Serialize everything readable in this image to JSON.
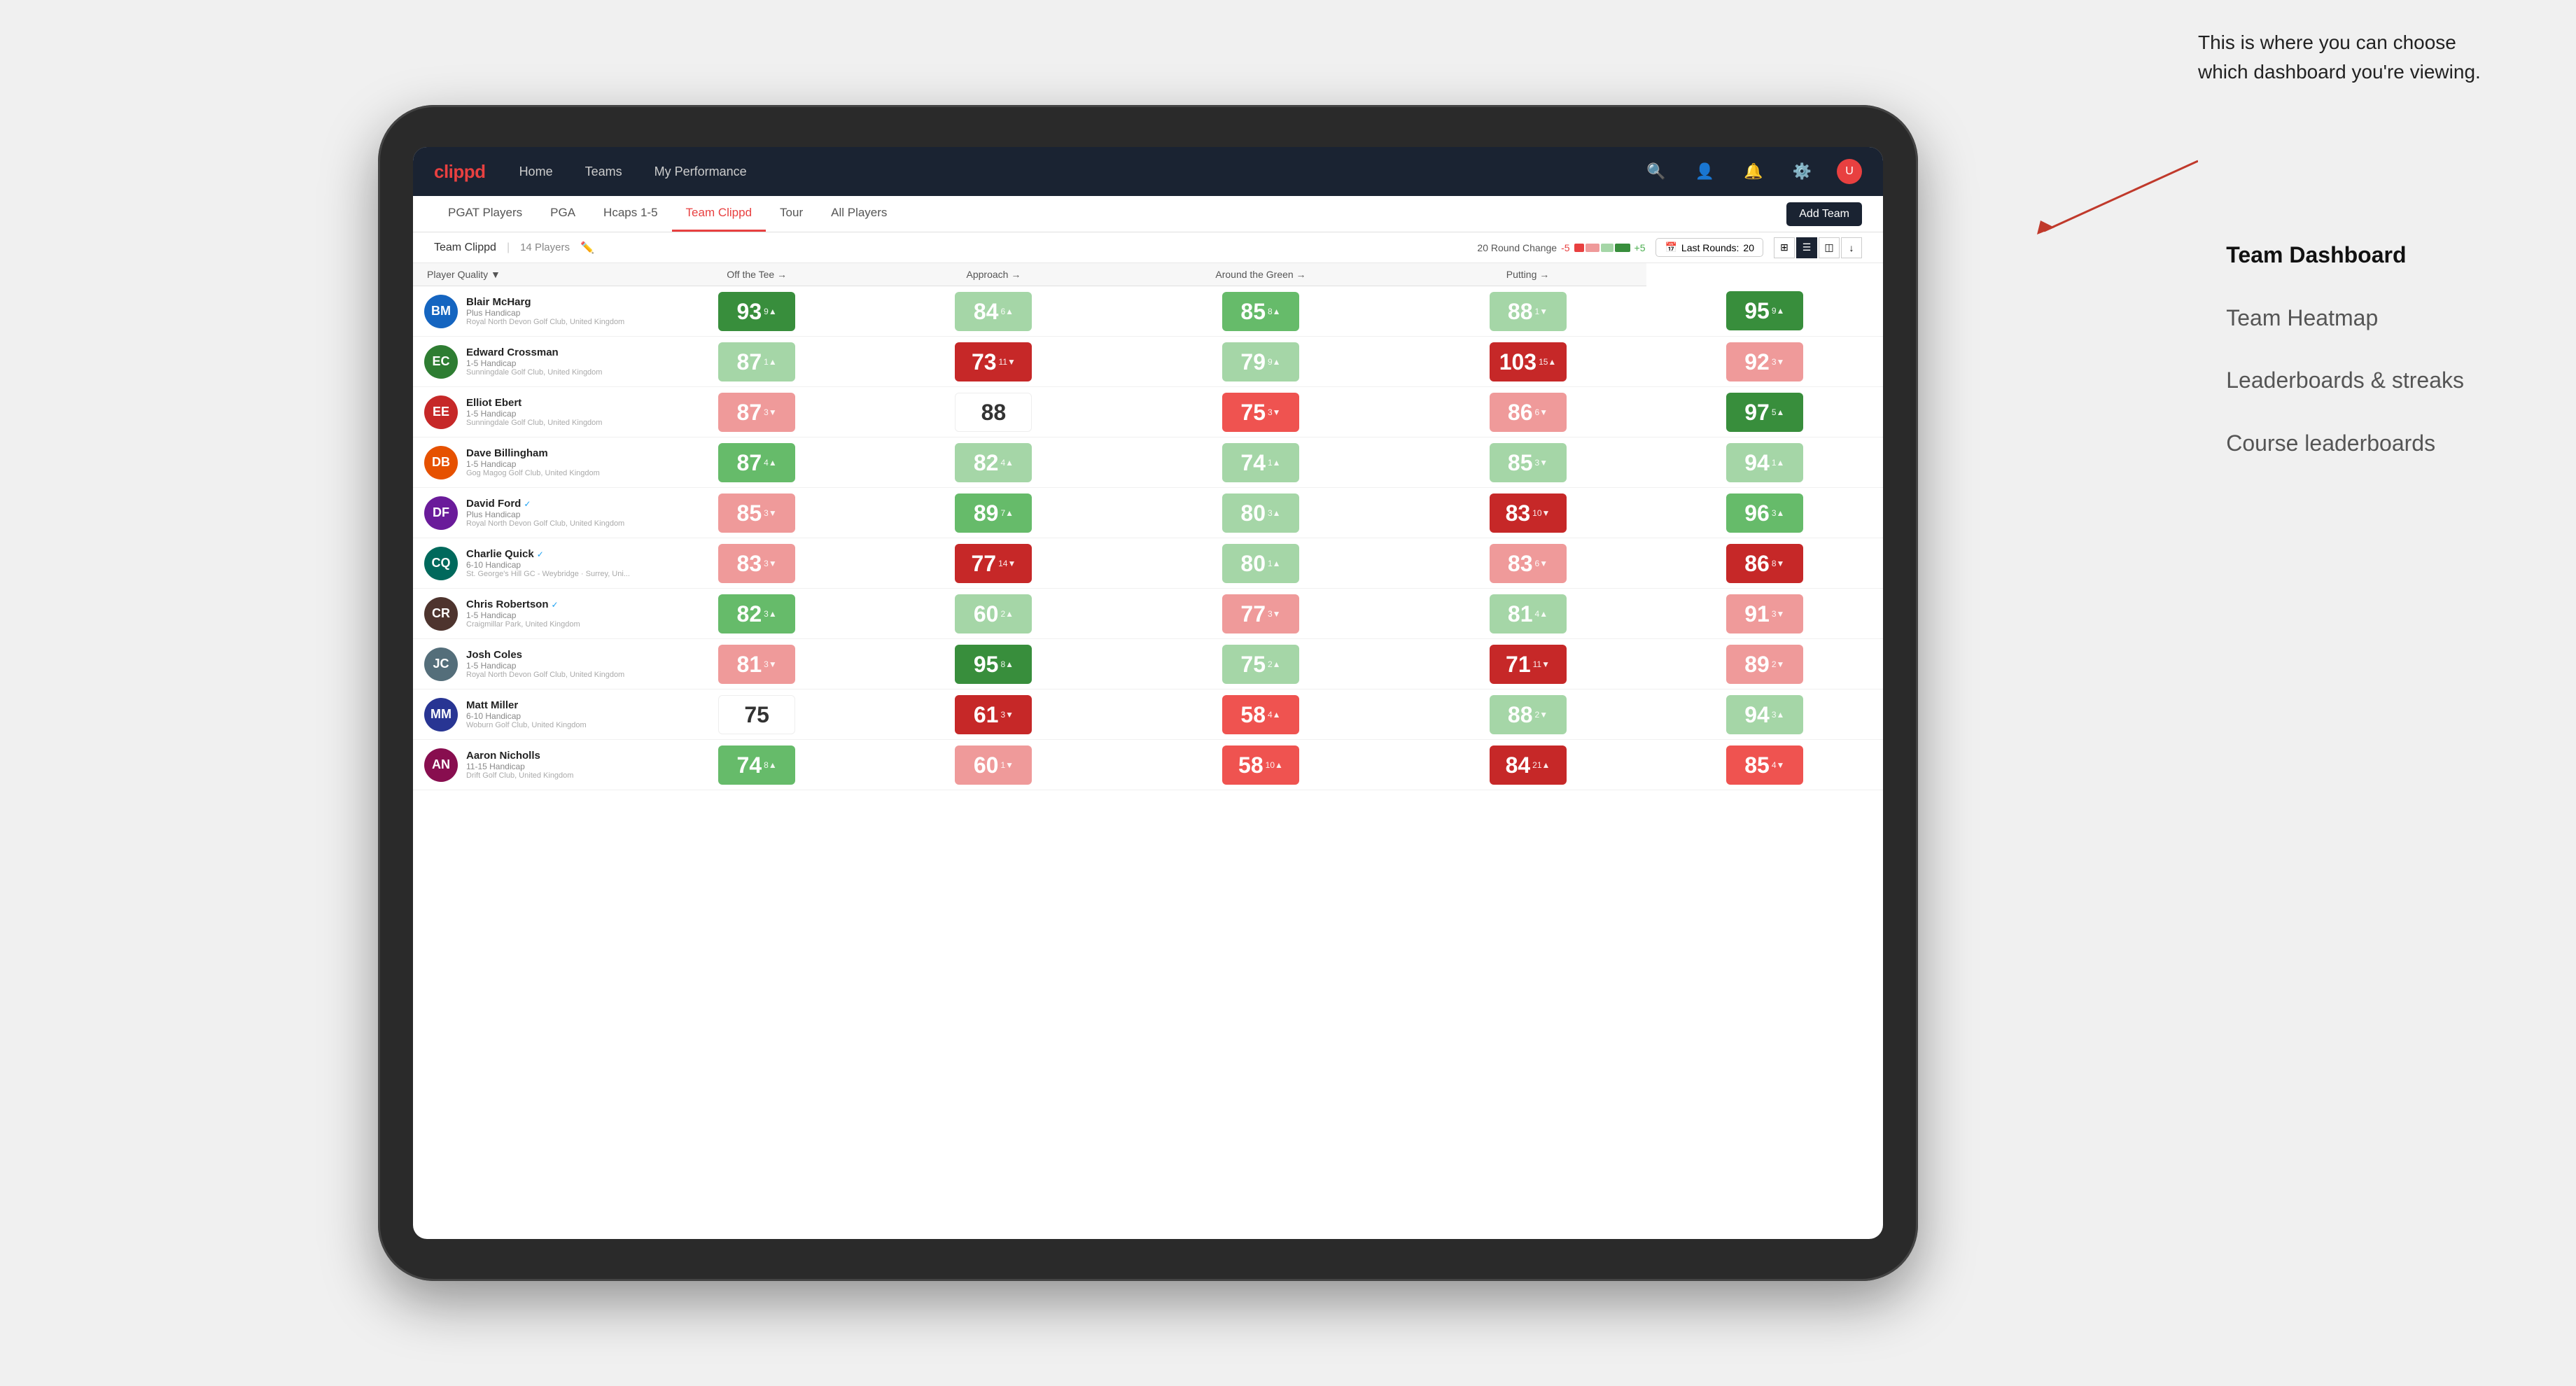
{
  "annotation": {
    "intro": "This is where you can choose which dashboard you're viewing.",
    "items": [
      "Team Dashboard",
      "Team Heatmap",
      "Leaderboards & streaks",
      "Course leaderboards"
    ]
  },
  "nav": {
    "logo": "clippd",
    "links": [
      "Home",
      "Teams",
      "My Performance"
    ],
    "icons": [
      "search",
      "person",
      "notifications",
      "settings"
    ]
  },
  "sub_nav": {
    "links": [
      "PGAT Players",
      "PGA",
      "Hcaps 1-5",
      "Team Clippd",
      "Tour",
      "All Players"
    ],
    "active": "Team Clippd",
    "add_team": "Add Team"
  },
  "team_bar": {
    "name": "Team Clippd",
    "separator": "|",
    "count": "14 Players",
    "round_change_label": "20 Round Change",
    "neg": "-5",
    "pos": "+5",
    "last_rounds_label": "Last Rounds:",
    "last_rounds_value": "20"
  },
  "table": {
    "headers": [
      "Player Quality ▼",
      "Off the Tee →",
      "Approach →",
      "Around the Green →",
      "Putting →"
    ],
    "players": [
      {
        "name": "Blair McHarg",
        "handicap": "Plus Handicap",
        "club": "Royal North Devon Golf Club, United Kingdom",
        "av_color": "av-blue",
        "av_initials": "BM",
        "scores": [
          {
            "value": "93",
            "change": "9",
            "dir": "up",
            "color": "green-dark"
          },
          {
            "value": "84",
            "change": "6",
            "dir": "up",
            "color": "green-light"
          },
          {
            "value": "85",
            "change": "8",
            "dir": "up",
            "color": "green-med"
          },
          {
            "value": "88",
            "change": "1",
            "dir": "down",
            "color": "green-light"
          },
          {
            "value": "95",
            "change": "9",
            "dir": "up",
            "color": "green-dark"
          }
        ]
      },
      {
        "name": "Edward Crossman",
        "handicap": "1-5 Handicap",
        "club": "Sunningdale Golf Club, United Kingdom",
        "av_color": "av-green",
        "av_initials": "EC",
        "scores": [
          {
            "value": "87",
            "change": "1",
            "dir": "up",
            "color": "green-light"
          },
          {
            "value": "73",
            "change": "11",
            "dir": "down",
            "color": "red-dark"
          },
          {
            "value": "79",
            "change": "9",
            "dir": "up",
            "color": "green-light"
          },
          {
            "value": "103",
            "change": "15",
            "dir": "up",
            "color": "red-dark"
          },
          {
            "value": "92",
            "change": "3",
            "dir": "down",
            "color": "red-light"
          }
        ]
      },
      {
        "name": "Elliot Ebert",
        "handicap": "1-5 Handicap",
        "club": "Sunningdale Golf Club, United Kingdom",
        "av_color": "av-red",
        "av_initials": "EE",
        "scores": [
          {
            "value": "87",
            "change": "3",
            "dir": "down",
            "color": "red-light"
          },
          {
            "value": "88",
            "change": "",
            "dir": "",
            "color": "white-cell"
          },
          {
            "value": "75",
            "change": "3",
            "dir": "down",
            "color": "red-med"
          },
          {
            "value": "86",
            "change": "6",
            "dir": "down",
            "color": "red-light"
          },
          {
            "value": "97",
            "change": "5",
            "dir": "up",
            "color": "green-dark"
          }
        ]
      },
      {
        "name": "Dave Billingham",
        "handicap": "1-5 Handicap",
        "club": "Gog Magog Golf Club, United Kingdom",
        "av_color": "av-orange",
        "av_initials": "DB",
        "scores": [
          {
            "value": "87",
            "change": "4",
            "dir": "up",
            "color": "green-med"
          },
          {
            "value": "82",
            "change": "4",
            "dir": "up",
            "color": "green-light"
          },
          {
            "value": "74",
            "change": "1",
            "dir": "up",
            "color": "green-light"
          },
          {
            "value": "85",
            "change": "3",
            "dir": "down",
            "color": "green-light"
          },
          {
            "value": "94",
            "change": "1",
            "dir": "up",
            "color": "green-light"
          }
        ]
      },
      {
        "name": "David Ford",
        "handicap": "Plus Handicap",
        "club": "Royal North Devon Golf Club, United Kingdom",
        "verified": true,
        "av_color": "av-purple",
        "av_initials": "DF",
        "scores": [
          {
            "value": "85",
            "change": "3",
            "dir": "down",
            "color": "red-light"
          },
          {
            "value": "89",
            "change": "7",
            "dir": "up",
            "color": "green-med"
          },
          {
            "value": "80",
            "change": "3",
            "dir": "up",
            "color": "green-light"
          },
          {
            "value": "83",
            "change": "10",
            "dir": "down",
            "color": "red-dark"
          },
          {
            "value": "96",
            "change": "3",
            "dir": "up",
            "color": "green-med"
          }
        ]
      },
      {
        "name": "Charlie Quick",
        "handicap": "6-10 Handicap",
        "club": "St. George's Hill GC - Weybridge · Surrey, Uni...",
        "verified": true,
        "av_color": "av-teal",
        "av_initials": "CQ",
        "scores": [
          {
            "value": "83",
            "change": "3",
            "dir": "down",
            "color": "red-light"
          },
          {
            "value": "77",
            "change": "14",
            "dir": "down",
            "color": "red-dark"
          },
          {
            "value": "80",
            "change": "1",
            "dir": "up",
            "color": "green-light"
          },
          {
            "value": "83",
            "change": "6",
            "dir": "down",
            "color": "red-light"
          },
          {
            "value": "86",
            "change": "8",
            "dir": "down",
            "color": "red-dark"
          }
        ]
      },
      {
        "name": "Chris Robertson",
        "handicap": "1-5 Handicap",
        "club": "Craigmillar Park, United Kingdom",
        "verified": true,
        "av_color": "av-brown",
        "av_initials": "CR",
        "scores": [
          {
            "value": "82",
            "change": "3",
            "dir": "up",
            "color": "green-med"
          },
          {
            "value": "60",
            "change": "2",
            "dir": "up",
            "color": "green-light"
          },
          {
            "value": "77",
            "change": "3",
            "dir": "down",
            "color": "red-light"
          },
          {
            "value": "81",
            "change": "4",
            "dir": "up",
            "color": "green-light"
          },
          {
            "value": "91",
            "change": "3",
            "dir": "down",
            "color": "red-light"
          }
        ]
      },
      {
        "name": "Josh Coles",
        "handicap": "1-5 Handicap",
        "club": "Royal North Devon Golf Club, United Kingdom",
        "av_color": "av-gray",
        "av_initials": "JC",
        "scores": [
          {
            "value": "81",
            "change": "3",
            "dir": "down",
            "color": "red-light"
          },
          {
            "value": "95",
            "change": "8",
            "dir": "up",
            "color": "green-dark"
          },
          {
            "value": "75",
            "change": "2",
            "dir": "up",
            "color": "green-light"
          },
          {
            "value": "71",
            "change": "11",
            "dir": "down",
            "color": "red-dark"
          },
          {
            "value": "89",
            "change": "2",
            "dir": "down",
            "color": "red-light"
          }
        ]
      },
      {
        "name": "Matt Miller",
        "handicap": "6-10 Handicap",
        "club": "Woburn Golf Club, United Kingdom",
        "av_color": "av-indigo",
        "av_initials": "MM",
        "scores": [
          {
            "value": "75",
            "change": "",
            "dir": "",
            "color": "white-cell"
          },
          {
            "value": "61",
            "change": "3",
            "dir": "down",
            "color": "red-dark"
          },
          {
            "value": "58",
            "change": "4",
            "dir": "up",
            "color": "red-med"
          },
          {
            "value": "88",
            "change": "2",
            "dir": "down",
            "color": "green-light"
          },
          {
            "value": "94",
            "change": "3",
            "dir": "up",
            "color": "green-light"
          }
        ]
      },
      {
        "name": "Aaron Nicholls",
        "handicap": "11-15 Handicap",
        "club": "Drift Golf Club, United Kingdom",
        "av_color": "av-pink",
        "av_initials": "AN",
        "scores": [
          {
            "value": "74",
            "change": "8",
            "dir": "up",
            "color": "green-med"
          },
          {
            "value": "60",
            "change": "1",
            "dir": "down",
            "color": "red-light"
          },
          {
            "value": "58",
            "change": "10",
            "dir": "up",
            "color": "red-med"
          },
          {
            "value": "84",
            "change": "21",
            "dir": "up",
            "color": "red-dark"
          },
          {
            "value": "85",
            "change": "4",
            "dir": "down",
            "color": "red-med"
          }
        ]
      }
    ]
  }
}
